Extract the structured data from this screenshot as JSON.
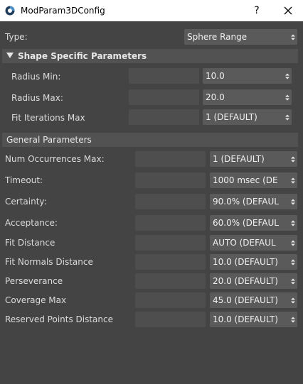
{
  "window": {
    "title": "ModParam3DConfig",
    "help_label": "?",
    "icons": {
      "app": "app-logo-icon",
      "close": "close-icon"
    }
  },
  "type_row": {
    "label": "Type:",
    "value": "Sphere Range"
  },
  "shape_section": {
    "title": "Shape Specific Parameters",
    "rows": [
      {
        "label": "Radius Min:",
        "value": "10.0"
      },
      {
        "label": "Radius Max:",
        "value": "20.0"
      },
      {
        "label": "Fit Iterations Max",
        "value": "1 (DEFAULT)"
      }
    ]
  },
  "general_section": {
    "title": "General Parameters",
    "rows": [
      {
        "label": "Num Occurrences Max:",
        "value": "1 (DEFAULT)"
      },
      {
        "label": "Timeout:",
        "value": "1000 msec (DE"
      },
      {
        "label": "Certainty:",
        "value": "90.0% (DEFAUL"
      },
      {
        "label": "Acceptance:",
        "value": "60.0% (DEFAUL"
      },
      {
        "label": "Fit Distance",
        "value": "AUTO (DEFAUL"
      },
      {
        "label": "Fit Normals Distance",
        "value": "10.0 (DEFAULT)"
      },
      {
        "label": "Perseverance",
        "value": "20.0 (DEFAULT)"
      },
      {
        "label": "Coverage Max",
        "value": "45.0 (DEFAULT)"
      },
      {
        "label": "Reserved Points Distance",
        "value": "10.0 (DEFAULT)"
      }
    ]
  },
  "colors": {
    "background": "#444444",
    "section_header": "#525252",
    "dropdown": "#5a5a5a",
    "titlebar": "#ffffff"
  }
}
